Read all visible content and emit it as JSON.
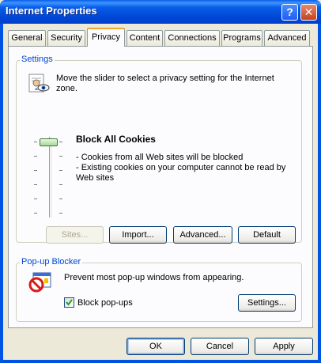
{
  "window": {
    "title": "Internet Properties",
    "help_button": "?",
    "close_button": "✕"
  },
  "tabs": [
    {
      "label": "General"
    },
    {
      "label": "Security"
    },
    {
      "label": "Privacy",
      "active": true
    },
    {
      "label": "Content"
    },
    {
      "label": "Connections"
    },
    {
      "label": "Programs"
    },
    {
      "label": "Advanced"
    }
  ],
  "settings": {
    "legend": "Settings",
    "instruction_line1": "Move the slider to select a privacy setting for the Internet",
    "instruction_line2": "zone.",
    "level_title": "Block All Cookies",
    "level_desc_line1": "- Cookies from all Web sites will be blocked",
    "level_desc_line2": "- Existing cookies on your computer cannot be read by",
    "level_desc_line3": "Web sites",
    "slider_level": "top",
    "buttons": {
      "sites": "Sites...",
      "import": "Import...",
      "advanced": "Advanced...",
      "default": "Default"
    }
  },
  "popup": {
    "legend": "Pop-up Blocker",
    "description": "Prevent most pop-up windows from appearing.",
    "checkbox_label": "Block pop-ups",
    "checkbox_checked": true,
    "settings_button": "Settings..."
  },
  "footer": {
    "ok": "OK",
    "cancel": "Cancel",
    "apply": "Apply"
  },
  "colors": {
    "titlebar": "#0054e3",
    "legend_text": "#0046d5",
    "dialog_bg": "#ece9d8",
    "panel_bg": "#fcfcfe"
  }
}
